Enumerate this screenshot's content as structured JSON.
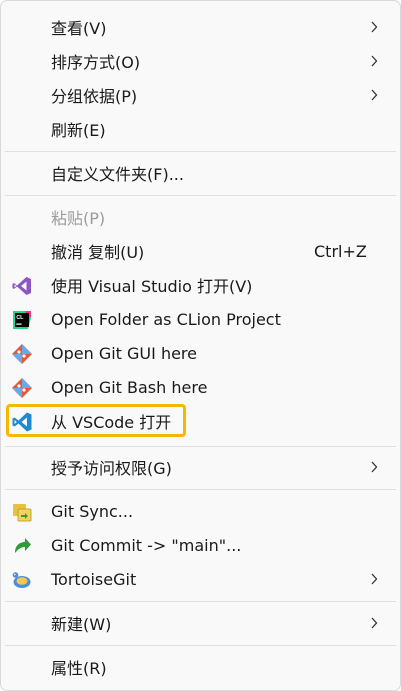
{
  "menu": {
    "items": [
      {
        "label": "查看(V)"
      },
      {
        "label": "排序方式(O)"
      },
      {
        "label": "分组依据(P)"
      },
      {
        "label": "刷新(E)"
      },
      {
        "label": "自定义文件夹(F)..."
      },
      {
        "label": "粘贴(P)"
      },
      {
        "label": "撤消 复制(U)",
        "shortcut": "Ctrl+Z"
      },
      {
        "label": "使用 Visual Studio 打开(V)",
        "icon": "visual-studio-icon"
      },
      {
        "label": "Open Folder as CLion Project",
        "icon": "clion-icon"
      },
      {
        "label": "Open Git GUI here",
        "icon": "git-icon"
      },
      {
        "label": "Open Git Bash here",
        "icon": "git-icon"
      },
      {
        "label": "从 VSCode 打开",
        "icon": "vscode-icon"
      },
      {
        "label": "授予访问权限(G)"
      },
      {
        "label": "Git Sync...",
        "icon": "git-sync-icon"
      },
      {
        "label": "Git Commit -> \"main\"...",
        "icon": "git-commit-icon"
      },
      {
        "label": "TortoiseGit",
        "icon": "tortoisegit-icon"
      },
      {
        "label": "新建(W)"
      },
      {
        "label": "属性(R)"
      }
    ]
  },
  "colors": {
    "highlight_border": "#f5b800",
    "disabled_text": "#9c9c9c",
    "visual_studio": "#8c56c6",
    "clion": "#21d789",
    "git": "#e05a3a",
    "vscode": "#1f8ad2"
  }
}
